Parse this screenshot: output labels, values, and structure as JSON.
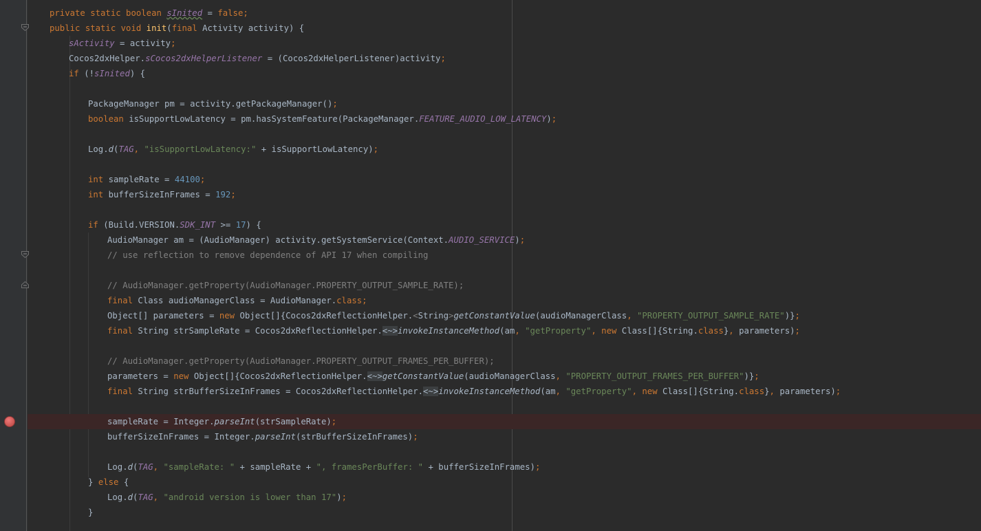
{
  "editor": {
    "colors": {
      "background": "#2b2b2b",
      "gutter": "#313335",
      "keyword": "#cc7832",
      "field": "#9876aa",
      "string": "#6a8759",
      "number": "#6897bb",
      "comment": "#808080",
      "function": "#ffc66d",
      "breakpoint": "#c75450",
      "breakpoint_line": "#3b2626"
    },
    "gutter_icons": [
      "fold-icon",
      "breakpoint-icon",
      "lightbulb-icon"
    ],
    "lines": [
      {
        "indent": 0,
        "tokens": [
          {
            "c": "kw",
            "t": "private static boolean "
          },
          {
            "c": "fs uw",
            "t": "sInited"
          },
          {
            "c": "",
            "t": " = "
          },
          {
            "c": "kw",
            "t": "false;"
          }
        ]
      },
      {
        "indent": 0,
        "tokens": [
          {
            "c": "kw",
            "t": "public static void "
          },
          {
            "c": "fn",
            "t": "init"
          },
          {
            "c": "",
            "t": "("
          },
          {
            "c": "kw",
            "t": "final "
          },
          {
            "c": "",
            "t": "Activity activity) {"
          }
        ]
      },
      {
        "indent": 1,
        "tokens": [
          {
            "c": "fs",
            "t": "sActivity"
          },
          {
            "c": "",
            "t": " = activity"
          },
          {
            "c": "kw",
            "t": ";"
          }
        ]
      },
      {
        "indent": 1,
        "tokens": [
          {
            "c": "",
            "t": "Cocos2dxHelper."
          },
          {
            "c": "fs",
            "t": "sCocos2dxHelperListener"
          },
          {
            "c": "",
            "t": " = (Cocos2dxHelperListener)activity"
          },
          {
            "c": "kw",
            "t": ";"
          }
        ]
      },
      {
        "indent": 1,
        "tokens": [
          {
            "c": "kw",
            "t": "if "
          },
          {
            "c": "",
            "t": "(!"
          },
          {
            "c": "fs",
            "t": "sInited"
          },
          {
            "c": "",
            "t": ") {"
          }
        ]
      },
      {
        "indent": 2,
        "tokens": []
      },
      {
        "indent": 2,
        "tokens": [
          {
            "c": "",
            "t": "PackageManager pm = activity.getPackageManager()"
          },
          {
            "c": "kw",
            "t": ";"
          }
        ]
      },
      {
        "indent": 2,
        "tokens": [
          {
            "c": "kw",
            "t": "boolean "
          },
          {
            "c": "",
            "t": "isSupportLowLatency = pm.hasSystemFeature(PackageManager."
          },
          {
            "c": "fs",
            "t": "FEATURE_AUDIO_LOW_LATENCY"
          },
          {
            "c": "",
            "t": ")"
          },
          {
            "c": "kw",
            "t": ";"
          }
        ]
      },
      {
        "indent": 2,
        "tokens": []
      },
      {
        "indent": 2,
        "tokens": [
          {
            "c": "",
            "t": "Log."
          },
          {
            "c": "mc",
            "t": "d"
          },
          {
            "c": "",
            "t": "("
          },
          {
            "c": "fs",
            "t": "TAG"
          },
          {
            "c": "kw",
            "t": ", "
          },
          {
            "c": "st",
            "t": "\"isSupportLowLatency:\""
          },
          {
            "c": "",
            "t": " + isSupportLowLatency)"
          },
          {
            "c": "kw",
            "t": ";"
          }
        ]
      },
      {
        "indent": 2,
        "tokens": []
      },
      {
        "indent": 2,
        "tokens": [
          {
            "c": "kw",
            "t": "int "
          },
          {
            "c": "",
            "t": "sampleRate = "
          },
          {
            "c": "nm",
            "t": "44100"
          },
          {
            "c": "kw",
            "t": ";"
          }
        ]
      },
      {
        "indent": 2,
        "tokens": [
          {
            "c": "kw",
            "t": "int "
          },
          {
            "c": "",
            "t": "bufferSizeInFrames = "
          },
          {
            "c": "nm",
            "t": "192"
          },
          {
            "c": "kw",
            "t": ";"
          }
        ]
      },
      {
        "indent": 2,
        "tokens": []
      },
      {
        "indent": 2,
        "tokens": [
          {
            "c": "kw",
            "t": "if "
          },
          {
            "c": "",
            "t": "(Build.VERSION."
          },
          {
            "c": "fs",
            "t": "SDK_INT"
          },
          {
            "c": "",
            "t": " >= "
          },
          {
            "c": "nm",
            "t": "17"
          },
          {
            "c": "",
            "t": ") {"
          }
        ]
      },
      {
        "indent": 3,
        "tokens": [
          {
            "c": "",
            "t": "AudioManager am = (AudioManager) activity.getSystemService(Context."
          },
          {
            "c": "fs",
            "t": "AUDIO_SERVICE"
          },
          {
            "c": "",
            "t": ")"
          },
          {
            "c": "kw",
            "t": ";"
          }
        ]
      },
      {
        "indent": 3,
        "tokens": [
          {
            "c": "cm",
            "t": "// use reflection to remove dependence of API 17 when compiling"
          }
        ]
      },
      {
        "indent": 3,
        "tokens": []
      },
      {
        "indent": 3,
        "tokens": [
          {
            "c": "cm",
            "t": "// AudioManager.getProperty(AudioManager.PROPERTY_OUTPUT_SAMPLE_RATE);"
          }
        ]
      },
      {
        "indent": 3,
        "tokens": [
          {
            "c": "kw",
            "t": "final "
          },
          {
            "c": "",
            "t": "Class audioManagerClass = AudioManager."
          },
          {
            "c": "kw",
            "t": "class;"
          }
        ]
      },
      {
        "indent": 3,
        "tokens": [
          {
            "c": "",
            "t": "Object[] parameters = "
          },
          {
            "c": "kw",
            "t": "new "
          },
          {
            "c": "",
            "t": "Object[]{Cocos2dxReflectionHelper."
          },
          {
            "c": "cm",
            "t": "<"
          },
          {
            "c": "",
            "t": "String"
          },
          {
            "c": "cm",
            "t": ">"
          },
          {
            "c": "mc",
            "t": "getConstantValue"
          },
          {
            "c": "",
            "t": "(audioManagerClass"
          },
          {
            "c": "kw",
            "t": ", "
          },
          {
            "c": "st",
            "t": "\"PROPERTY_OUTPUT_SAMPLE_RATE\""
          },
          {
            "c": "",
            "t": ")}"
          },
          {
            "c": "kw",
            "t": ";"
          }
        ]
      },
      {
        "indent": 3,
        "tokens": [
          {
            "c": "kw",
            "t": "final "
          },
          {
            "c": "",
            "t": "String strSampleRate = Cocos2dxReflectionHelper."
          },
          {
            "c": "tp",
            "t": "<~>"
          },
          {
            "c": "mc",
            "t": "invokeInstanceMethod"
          },
          {
            "c": "",
            "t": "(am"
          },
          {
            "c": "kw",
            "t": ", "
          },
          {
            "c": "st",
            "t": "\"getProperty\""
          },
          {
            "c": "kw",
            "t": ", new "
          },
          {
            "c": "",
            "t": "Class[]{String."
          },
          {
            "c": "kw",
            "t": "class"
          },
          {
            "c": "",
            "t": "}"
          },
          {
            "c": "kw",
            "t": ", "
          },
          {
            "c": "",
            "t": "parameters)"
          },
          {
            "c": "kw",
            "t": ";"
          }
        ]
      },
      {
        "indent": 3,
        "tokens": []
      },
      {
        "indent": 3,
        "tokens": [
          {
            "c": "cm",
            "t": "// AudioManager.getProperty(AudioManager.PROPERTY_OUTPUT_FRAMES_PER_BUFFER);"
          }
        ]
      },
      {
        "indent": 3,
        "tokens": [
          {
            "c": "",
            "t": "parameters = "
          },
          {
            "c": "kw",
            "t": "new "
          },
          {
            "c": "",
            "t": "Object[]{Cocos2dxReflectionHelper."
          },
          {
            "c": "tp",
            "t": "<~>"
          },
          {
            "c": "mc",
            "t": "getConstantValue"
          },
          {
            "c": "",
            "t": "(audioManagerClass"
          },
          {
            "c": "kw",
            "t": ", "
          },
          {
            "c": "st",
            "t": "\"PROPERTY_OUTPUT_FRAMES_PER_BUFFER\""
          },
          {
            "c": "",
            "t": ")}"
          },
          {
            "c": "kw",
            "t": ";"
          }
        ]
      },
      {
        "indent": 3,
        "tokens": [
          {
            "c": "kw",
            "t": "final "
          },
          {
            "c": "",
            "t": "String strBufferSizeInFrames = Cocos2dxReflectionHelper."
          },
          {
            "c": "tp",
            "t": "<~>"
          },
          {
            "c": "mc",
            "t": "invokeInstanceMethod"
          },
          {
            "c": "",
            "t": "(am"
          },
          {
            "c": "kw",
            "t": ", "
          },
          {
            "c": "st",
            "t": "\"getProperty\""
          },
          {
            "c": "kw",
            "t": ", new "
          },
          {
            "c": "",
            "t": "Class[]{String."
          },
          {
            "c": "kw",
            "t": "class"
          },
          {
            "c": "",
            "t": "}"
          },
          {
            "c": "kw",
            "t": ", "
          },
          {
            "c": "",
            "t": "parameters)"
          },
          {
            "c": "kw",
            "t": ";"
          }
        ]
      },
      {
        "indent": 3,
        "tokens": []
      },
      {
        "indent": 3,
        "breakpoint": true,
        "tokens": [
          {
            "c": "",
            "t": "sampleRate = Integer."
          },
          {
            "c": "mc",
            "t": "parseInt"
          },
          {
            "c": "",
            "t": "(strSampleRate)"
          },
          {
            "c": "kw",
            "t": ";"
          }
        ]
      },
      {
        "indent": 3,
        "tokens": [
          {
            "c": "",
            "t": "bufferSizeInFrames = Integer."
          },
          {
            "c": "mc",
            "t": "parseInt"
          },
          {
            "c": "",
            "t": "(strBufferSizeInFrames)"
          },
          {
            "c": "kw",
            "t": ";"
          }
        ]
      },
      {
        "indent": 3,
        "tokens": []
      },
      {
        "indent": 3,
        "tokens": [
          {
            "c": "",
            "t": "Log."
          },
          {
            "c": "mc",
            "t": "d"
          },
          {
            "c": "",
            "t": "("
          },
          {
            "c": "fs",
            "t": "TAG"
          },
          {
            "c": "kw",
            "t": ", "
          },
          {
            "c": "st",
            "t": "\"sampleRate: \""
          },
          {
            "c": "",
            "t": " + sampleRate + "
          },
          {
            "c": "st",
            "t": "\", framesPerBuffer: \""
          },
          {
            "c": "",
            "t": " + bufferSizeInFrames)"
          },
          {
            "c": "kw",
            "t": ";"
          }
        ]
      },
      {
        "indent": 2,
        "tokens": [
          {
            "c": "",
            "t": "} "
          },
          {
            "c": "kw",
            "t": "else "
          },
          {
            "c": "",
            "t": "{"
          }
        ]
      },
      {
        "indent": 3,
        "tokens": [
          {
            "c": "",
            "t": "Log."
          },
          {
            "c": "mc",
            "t": "d"
          },
          {
            "c": "",
            "t": "("
          },
          {
            "c": "fs",
            "t": "TAG"
          },
          {
            "c": "kw",
            "t": ", "
          },
          {
            "c": "st",
            "t": "\"android version is lower than 17\""
          },
          {
            "c": "",
            "t": ")"
          },
          {
            "c": "kw",
            "t": ";"
          }
        ]
      },
      {
        "indent": 2,
        "tokens": [
          {
            "c": "",
            "t": "}"
          }
        ]
      }
    ]
  }
}
